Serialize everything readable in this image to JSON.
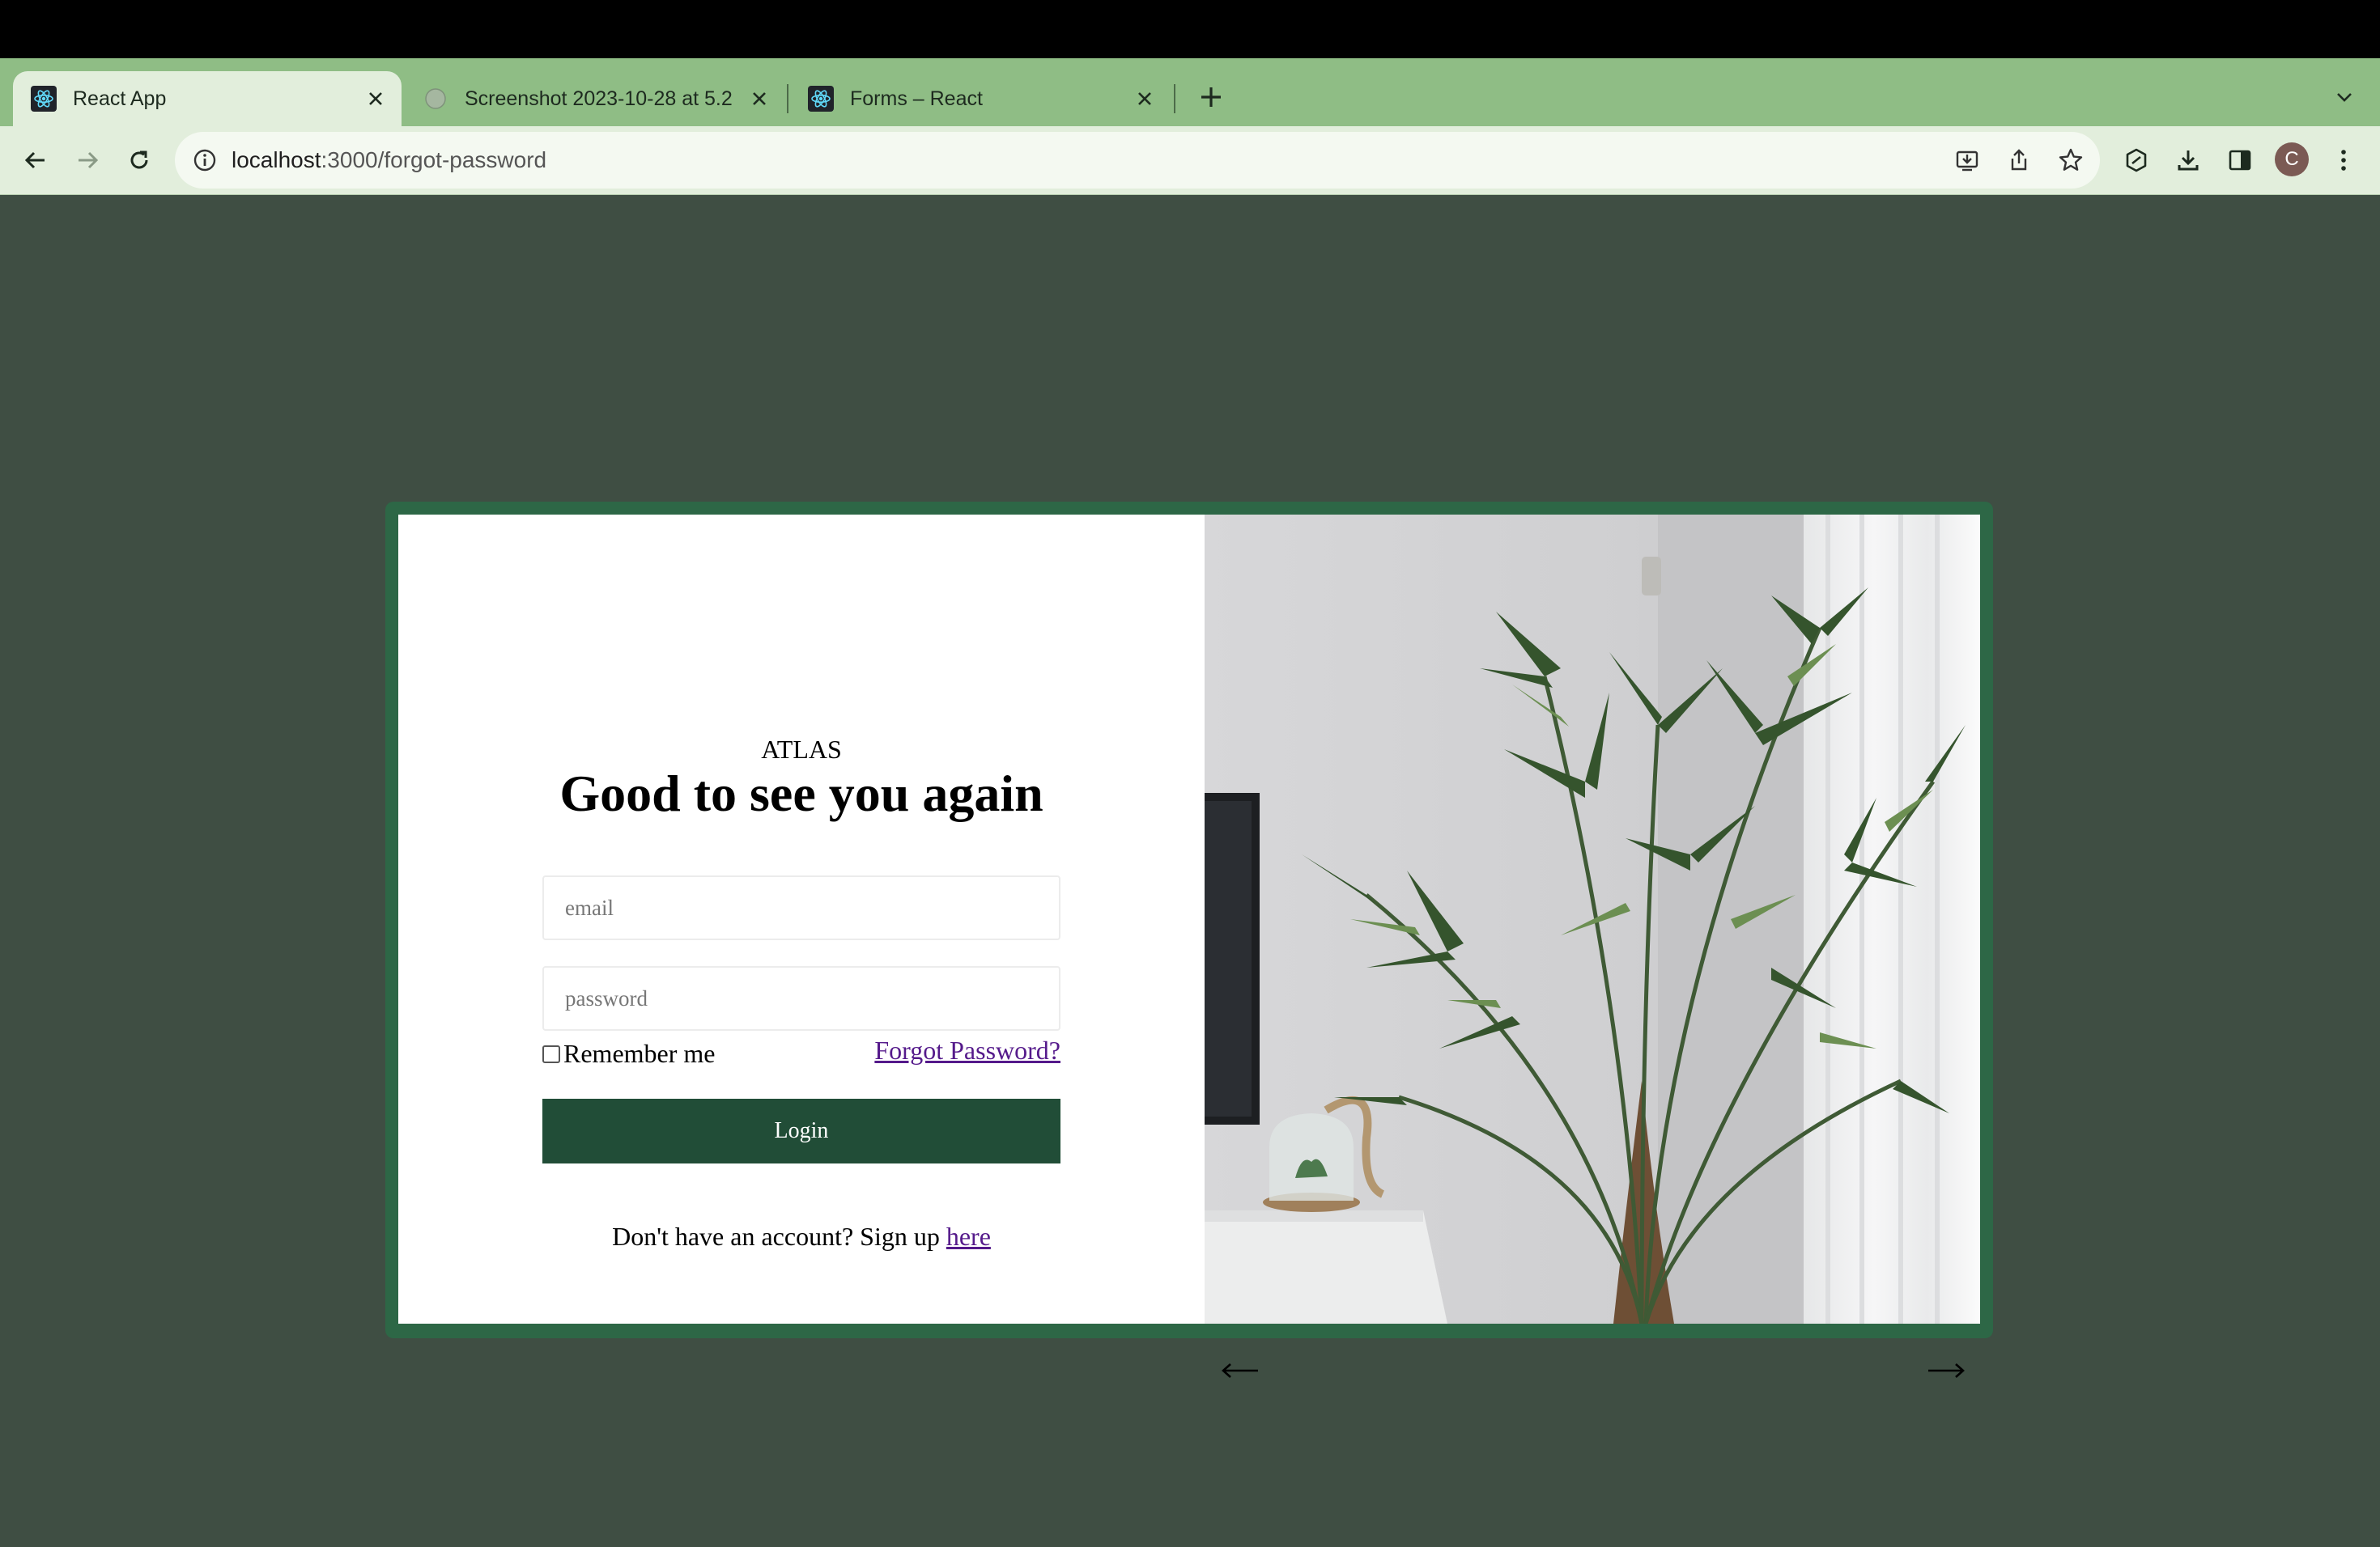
{
  "browser": {
    "tabs": [
      {
        "title": "React App",
        "favicon": "react-icon",
        "active": true
      },
      {
        "title": "Screenshot 2023-10-28 at 5.2",
        "favicon": "globe-icon",
        "active": false
      },
      {
        "title": "Forms – React",
        "favicon": "react-icon",
        "active": false
      }
    ],
    "url_host": "localhost",
    "url_path": ":3000/forgot-password",
    "profile_initial": "C"
  },
  "login": {
    "brand": "ATLAS",
    "headline": "Good to see you again",
    "email_placeholder": "email",
    "password_placeholder": "password",
    "remember_label": "Remember me",
    "forgot_link": "Forgot Password?",
    "login_button": "Login",
    "signup_text": "Don't have an account? Sign up ",
    "signup_link": "here"
  },
  "carousel": {
    "prev": "←",
    "next": "→"
  },
  "colors": {
    "page_bg": "#3f4e43",
    "frame": "#2d6746",
    "button": "#214d37",
    "tab_strip": "#8fbd85",
    "toolbar": "#e2eedc",
    "link": "#551a8b"
  }
}
